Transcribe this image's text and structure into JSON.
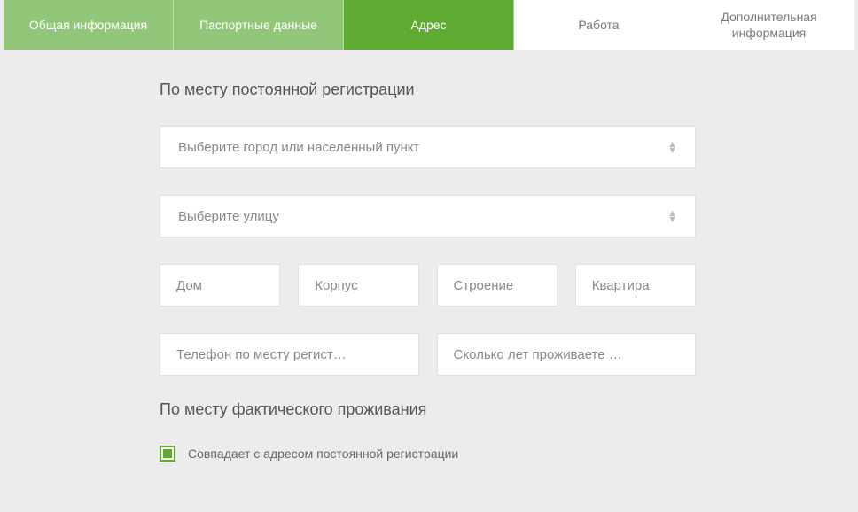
{
  "tabs": {
    "general": "Общая информация",
    "passport": "Паспортные данные",
    "address": "Адрес",
    "work": "Работа",
    "additional": "Дополнительная информация"
  },
  "section": {
    "registration_title": "По месту постоянной регистрации",
    "actual_title": "По месту фактического проживания"
  },
  "fields": {
    "city_placeholder": "Выберите город или населенный пункт",
    "street_placeholder": "Выберите улицу",
    "house_placeholder": "Дом",
    "korpus_placeholder": "Корпус",
    "stroenie_placeholder": "Строение",
    "flat_placeholder": "Квартира",
    "phone_placeholder": "Телефон по месту регист…",
    "years_placeholder": "Сколько лет проживаете …"
  },
  "checkbox": {
    "same_address_label": "Совпадает с адресом постоянной регистрации"
  }
}
